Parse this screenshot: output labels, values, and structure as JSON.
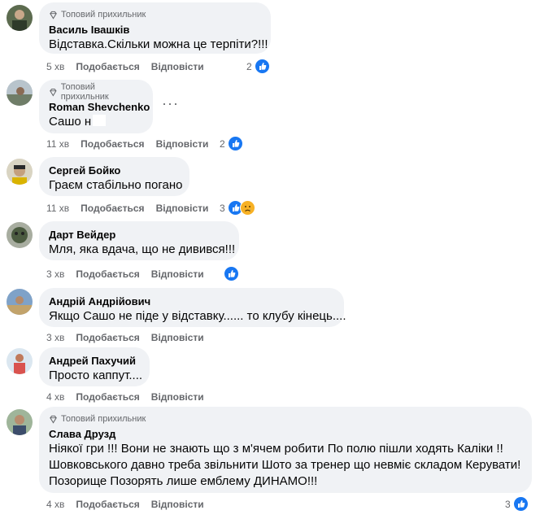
{
  "labels": {
    "like": "Подобається",
    "reply": "Відповісти",
    "top_fan": "Топовий прихильник"
  },
  "comments": [
    {
      "author": "Василь Івашків",
      "text": "Відставка.Скільки можна це терпіти?!!!",
      "time": "5 хв",
      "reactions": "2",
      "top_fan": true
    },
    {
      "author": "Roman Shevchenko",
      "text": "Сашо н",
      "time": "11 хв",
      "reactions": "2",
      "top_fan": true
    },
    {
      "author": "Сергей Бойко",
      "text": "Граєм стабільно погано",
      "time": "11 хв",
      "reactions": "3",
      "top_fan": false
    },
    {
      "author": "Дарт Вейдер",
      "text": "Мля, яка вдача, що не дивився!!!",
      "time": "3 хв",
      "reactions": "",
      "top_fan": false
    },
    {
      "author": "Андрій Андрійович",
      "text": "Якщо Сашо не піде у відставку...... то клубу кінець....",
      "time": "3 хв",
      "reactions": "",
      "top_fan": false
    },
    {
      "author": "Андрей Пахучий",
      "text": "Просто каппут....",
      "time": "4 хв",
      "reactions": "",
      "top_fan": false
    },
    {
      "author": "Слава Друзд",
      "text_lines": [
        "Ніякої гри !!! Вони не знають що з м'ячем робити По полю пішли ходять Каліки !!",
        "Шовковського давно треба звільнити Шото за тренер що невміє складом Керувати!",
        "Позорище Позорять лише емблему ДИНАМО!!!"
      ],
      "time": "4 хв",
      "reactions": "3",
      "top_fan": true
    }
  ],
  "colors": {
    "bubble": "#f0f2f5",
    "meta": "#65676b",
    "like_blue": "#1877f2",
    "sad_yellow": "#f7b125"
  }
}
